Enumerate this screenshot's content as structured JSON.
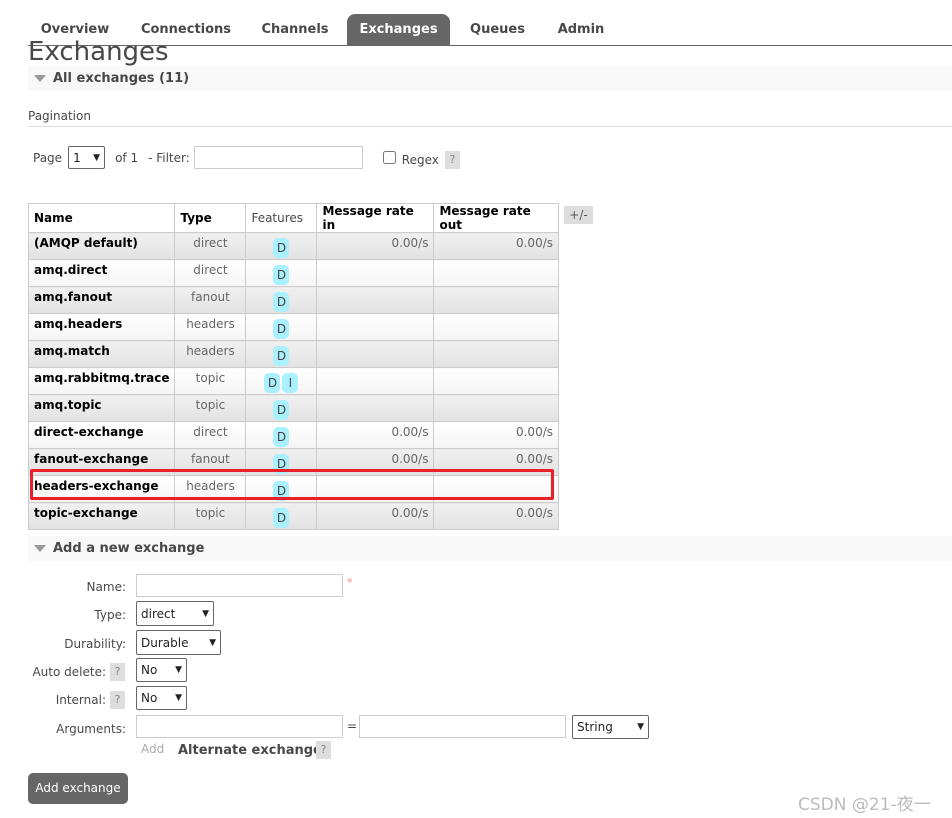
{
  "nav": {
    "tabs": [
      {
        "label": "Overview"
      },
      {
        "label": "Connections"
      },
      {
        "label": "Channels"
      },
      {
        "label": "Exchanges",
        "active": true
      },
      {
        "label": "Queues"
      },
      {
        "label": "Admin"
      }
    ]
  },
  "page_title": "Exchanges",
  "all_section": {
    "title": "All exchanges (11)"
  },
  "pagination": {
    "label": "Pagination",
    "page_label": "Page",
    "page_value": "1",
    "of_label": "of 1",
    "filter_label": "- Filter:",
    "filter_value": "",
    "regex_label": "Regex",
    "help": "?"
  },
  "table": {
    "columns": [
      "Name",
      "Type",
      "Features",
      "Message rate in",
      "Message rate out"
    ],
    "toggle": "+/-",
    "rows": [
      {
        "name": "(AMQP default)",
        "type": "direct",
        "features": [
          "D"
        ],
        "rate_in": "0.00/s",
        "rate_out": "0.00/s"
      },
      {
        "name": "amq.direct",
        "type": "direct",
        "features": [
          "D"
        ],
        "rate_in": "",
        "rate_out": ""
      },
      {
        "name": "amq.fanout",
        "type": "fanout",
        "features": [
          "D"
        ],
        "rate_in": "",
        "rate_out": ""
      },
      {
        "name": "amq.headers",
        "type": "headers",
        "features": [
          "D"
        ],
        "rate_in": "",
        "rate_out": ""
      },
      {
        "name": "amq.match",
        "type": "headers",
        "features": [
          "D"
        ],
        "rate_in": "",
        "rate_out": ""
      },
      {
        "name": "amq.rabbitmq.trace",
        "type": "topic",
        "features": [
          "D",
          "I"
        ],
        "rate_in": "",
        "rate_out": ""
      },
      {
        "name": "amq.topic",
        "type": "topic",
        "features": [
          "D"
        ],
        "rate_in": "",
        "rate_out": ""
      },
      {
        "name": "direct-exchange",
        "type": "direct",
        "features": [
          "D"
        ],
        "rate_in": "0.00/s",
        "rate_out": "0.00/s"
      },
      {
        "name": "fanout-exchange",
        "type": "fanout",
        "features": [
          "D"
        ],
        "rate_in": "0.00/s",
        "rate_out": "0.00/s"
      },
      {
        "name": "headers-exchange",
        "type": "headers",
        "features": [
          "D"
        ],
        "rate_in": "",
        "rate_out": "",
        "highlighted": true
      },
      {
        "name": "topic-exchange",
        "type": "topic",
        "features": [
          "D"
        ],
        "rate_in": "0.00/s",
        "rate_out": "0.00/s"
      }
    ]
  },
  "add_section": {
    "title": "Add a new exchange",
    "name_label": "Name:",
    "name_value": "",
    "required": "*",
    "type_label": "Type:",
    "type_value": "direct",
    "durability_label": "Durability:",
    "durability_value": "Durable",
    "auto_delete_label": "Auto delete:",
    "auto_delete_value": "No",
    "internal_label": "Internal:",
    "internal_value": "No",
    "arguments_label": "Arguments:",
    "arg_key": "",
    "equals": "=",
    "arg_value": "",
    "arg_type": "String",
    "add_link": "Add",
    "alternate_exchange": "Alternate exchange",
    "help": "?",
    "submit": "Add exchange"
  },
  "watermark": "CSDN @21-夜一",
  "colors": {
    "active_tab": "#666666",
    "badge": "#aaf0ff",
    "highlight": "#e8202a"
  }
}
